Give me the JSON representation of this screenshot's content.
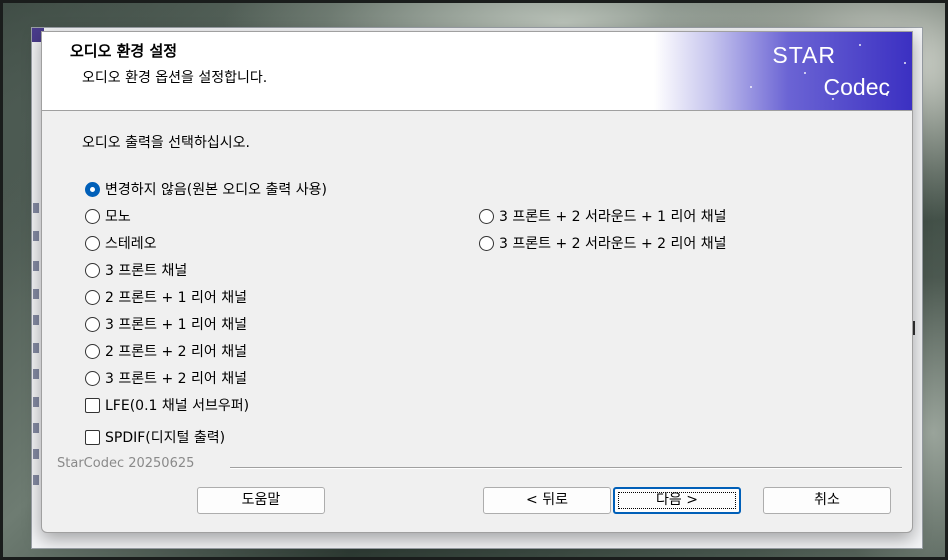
{
  "header": {
    "title": "오디오 환경 설정",
    "subtitle": "오디오 환경 옵션을 설정합니다."
  },
  "logo": {
    "line1": "STAR",
    "line2": "Codec",
    "colors": {
      "gradient_light": "#c7c6ee",
      "gradient_dark": "#3b30c2"
    }
  },
  "prompt": "오디오 출력을 선택하십시오.",
  "options_left": [
    {
      "label": "변경하지 않음(원본 오디오 출력 사용)",
      "type": "radio",
      "checked": true
    },
    {
      "label": "모노",
      "type": "radio",
      "checked": false
    },
    {
      "label": "스테레오",
      "type": "radio",
      "checked": false
    },
    {
      "label": "3 프론트 채널",
      "type": "radio",
      "checked": false
    },
    {
      "label": "2 프론트 + 1 리어 채널",
      "type": "radio",
      "checked": false
    },
    {
      "label": "3 프론트 + 1 리어 채널",
      "type": "radio",
      "checked": false
    },
    {
      "label": "2 프론트 + 2 리어 채널",
      "type": "radio",
      "checked": false
    },
    {
      "label": "3 프론트 + 2 리어 채널",
      "type": "radio",
      "checked": false
    }
  ],
  "options_right": [
    {
      "label": "3 프론트 + 2 서라운드 + 1 리어 채널",
      "type": "radio",
      "checked": false
    },
    {
      "label": "3 프론트 + 2 서라운드 + 2 리어 채널",
      "type": "radio",
      "checked": false
    }
  ],
  "checkboxes": [
    {
      "label": "LFE(0.1 채널 서브우퍼)",
      "checked": false
    },
    {
      "label": "SPDIF(디지털 출력)",
      "checked": false
    }
  ],
  "footer": {
    "brand": "StarCodec 20250625"
  },
  "buttons": {
    "help": "도움말",
    "back": "< 뒤로",
    "next": "다음 >",
    "cancel": "취소"
  },
  "colors": {
    "accent": "#005fb8",
    "dialog_bg": "#f0f0f0"
  }
}
